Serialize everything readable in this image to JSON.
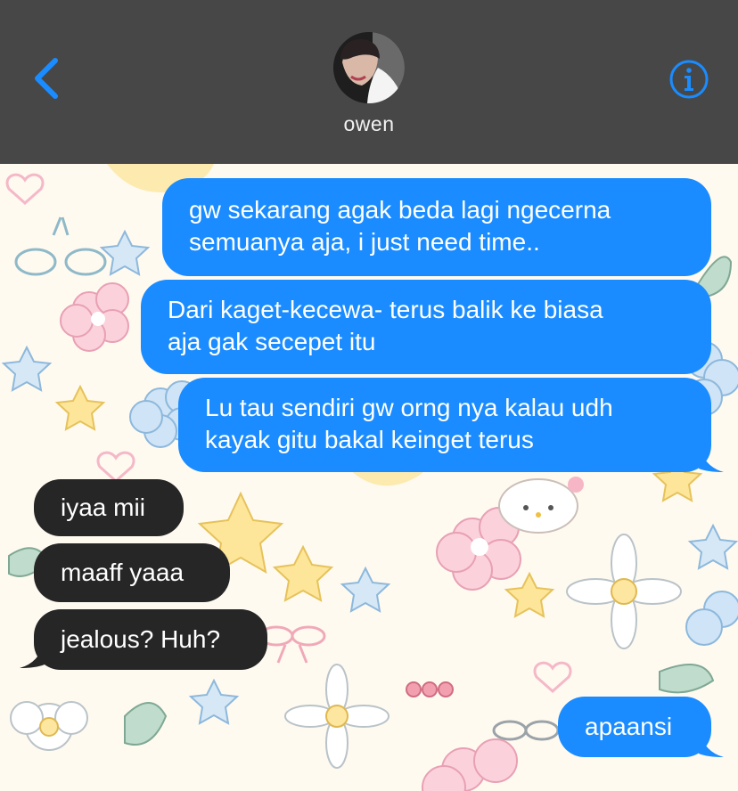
{
  "contact": {
    "name": "owen",
    "avatar_icon": "contact-avatar-photo"
  },
  "header": {
    "back_icon": "chevron-left-icon",
    "info_icon": "info-icon"
  },
  "colors": {
    "header_bg": "#474747",
    "accent": "#1a8cff",
    "sent_bubble": "#1a8cff",
    "received_bubble": "#262626",
    "wallpaper": "#fffaf0"
  },
  "messages": [
    {
      "direction": "sent",
      "text": "gw sekarang agak beda lagi ngecerna\nsemuanya aja, i just need time.."
    },
    {
      "direction": "sent",
      "text": "Dari kaget-kecewa- terus balik ke biasa\naja gak secepet itu"
    },
    {
      "direction": "sent",
      "text": "Lu tau sendiri gw orng nya kalau udh\nkayak gitu bakal keinget terus"
    },
    {
      "direction": "received",
      "text": "iyaa mii"
    },
    {
      "direction": "received",
      "text": "maaff yaaa"
    },
    {
      "direction": "received",
      "text": "jealous? Huh?"
    },
    {
      "direction": "sent",
      "text": "apaansi"
    }
  ]
}
